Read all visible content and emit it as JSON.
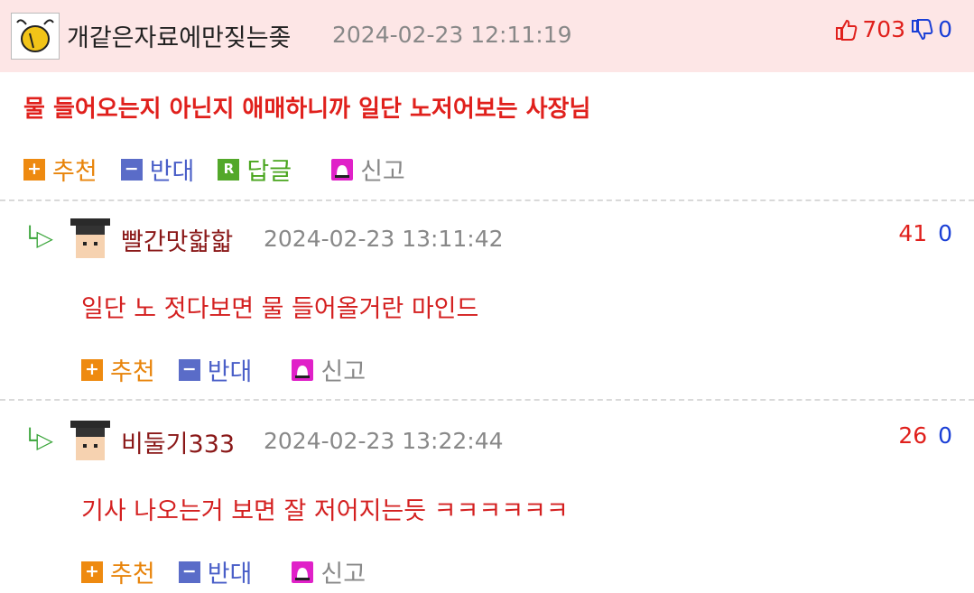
{
  "post": {
    "nickname": "개같은자료에만짖는좆",
    "timestamp": "2024-02-23 12:11:19",
    "upvotes": "703",
    "downvotes": "0",
    "text": "물 들어오는지 아닌지 애매하니까 일단 노저어보는 사장님",
    "up_icon": "thumbs-up-icon",
    "down_icon": "thumbs-down-icon"
  },
  "actions": {
    "recommend": "추천",
    "oppose": "반대",
    "reply": "답글",
    "report": "신고",
    "reply_icon_letter": "R"
  },
  "replies": [
    {
      "nickname": "빨간맛핣핣",
      "timestamp": "2024-02-23 13:11:42",
      "upvotes": "41",
      "downvotes": "0",
      "text": "일단 노 젓다보면 물 들어올거란 마인드"
    },
    {
      "nickname": "비둘기333",
      "timestamp": "2024-02-23 13:22:44",
      "upvotes": "26",
      "downvotes": "0",
      "text": "기사 나오는거 보면 잘 저어지는듯 ㅋㅋㅋㅋㅋㅋ"
    }
  ],
  "colors": {
    "highlight_bg": "#fde6e6",
    "upvote": "#e0201c",
    "downvote": "#1a3fd6",
    "recommend": "#e8840b",
    "oppose": "#4a5fc8",
    "reply": "#4aa61f",
    "report": "#e021c8"
  }
}
